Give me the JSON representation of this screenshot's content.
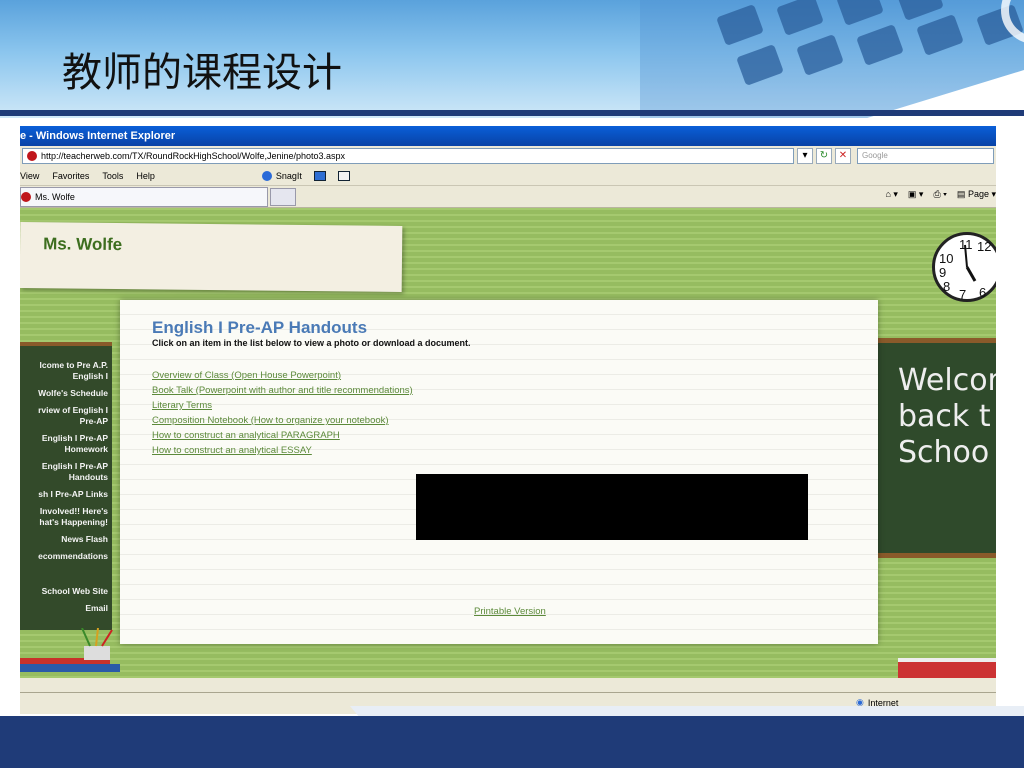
{
  "slide": {
    "title": "教师的课程设计"
  },
  "browser": {
    "window_title": "e - Windows Internet Explorer",
    "url": "http://teacherweb.com/TX/RoundRockHighSchool/Wolfe,Jenine/photo3.aspx",
    "search_placeholder": "Google",
    "menu": [
      "View",
      "Favorites",
      "Tools",
      "Help"
    ],
    "snagit_label": "SnagIt",
    "tab_label": "Ms. Wolfe",
    "page_menu_label": "Page",
    "status_zone": "Internet"
  },
  "page": {
    "site_name": "Ms. Wolfe",
    "clock_numbers": [
      "11",
      "12",
      "10",
      "9",
      "8",
      "7",
      "6"
    ],
    "welcome": [
      "Welcom",
      "back t",
      "Schoo"
    ],
    "nav": [
      "lcome to Pre A.P.",
      "English I",
      "Wolfe's Schedule",
      "rview of English I",
      "Pre-AP",
      "English I Pre-AP",
      "Homework",
      "English I Pre-AP",
      "Handouts",
      "sh I Pre-AP Links",
      "Involved!! Here's",
      "hat's Happening!",
      "News Flash",
      "ecommendations",
      "School Web Site",
      "Email"
    ],
    "heading": "English I Pre-AP Handouts",
    "instruction": "Click on an item in the list below to view a photo or download a document.",
    "links": [
      "Overview of Class (Open House Powerpoint)",
      "Book Talk (Powerpoint with author and title recommendations)",
      "Literary Terms",
      "Composition Notebook (How to organize your notebook)",
      "How to construct an analytical PARAGRAPH",
      "How to construct an analytical ESSAY"
    ],
    "printable_label": "Printable Version"
  },
  "colors": {
    "slide_navy": "#1f3b78",
    "wall_green": "#9ac063",
    "heading_blue": "#4a7ab6",
    "link_green": "#5c8a3a"
  }
}
